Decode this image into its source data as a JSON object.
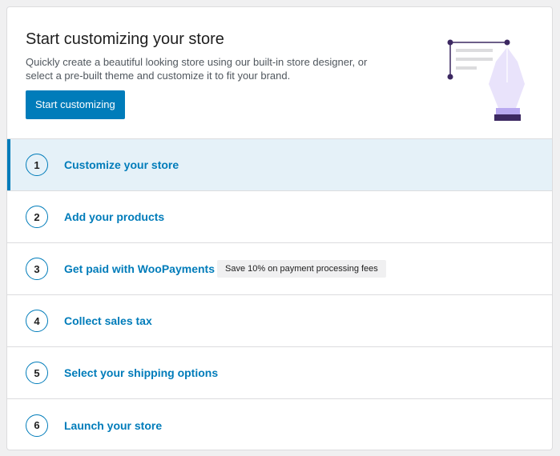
{
  "header": {
    "title": "Start customizing your store",
    "description": "Quickly create a beautiful looking store using our built-in store designer, or select a pre-built theme and customize it to fit your brand.",
    "button_label": "Start customizing",
    "illustration_icon": "pen-tool-design-icon"
  },
  "colors": {
    "accent": "#007cba",
    "active_row_bg": "#e5f1f8",
    "badge_bg": "#f0f0f1",
    "illustration_purple": "#3c2861",
    "illustration_lavender": "#e9e3fb"
  },
  "tasks": [
    {
      "number": "1",
      "label": "Customize your store",
      "active": true
    },
    {
      "number": "2",
      "label": "Add your products"
    },
    {
      "number": "3",
      "label": "Get paid with WooPayments",
      "badge": "Save 10% on payment processing fees"
    },
    {
      "number": "4",
      "label": "Collect sales tax"
    },
    {
      "number": "5",
      "label": "Select your shipping options"
    },
    {
      "number": "6",
      "label": "Launch your store"
    }
  ]
}
